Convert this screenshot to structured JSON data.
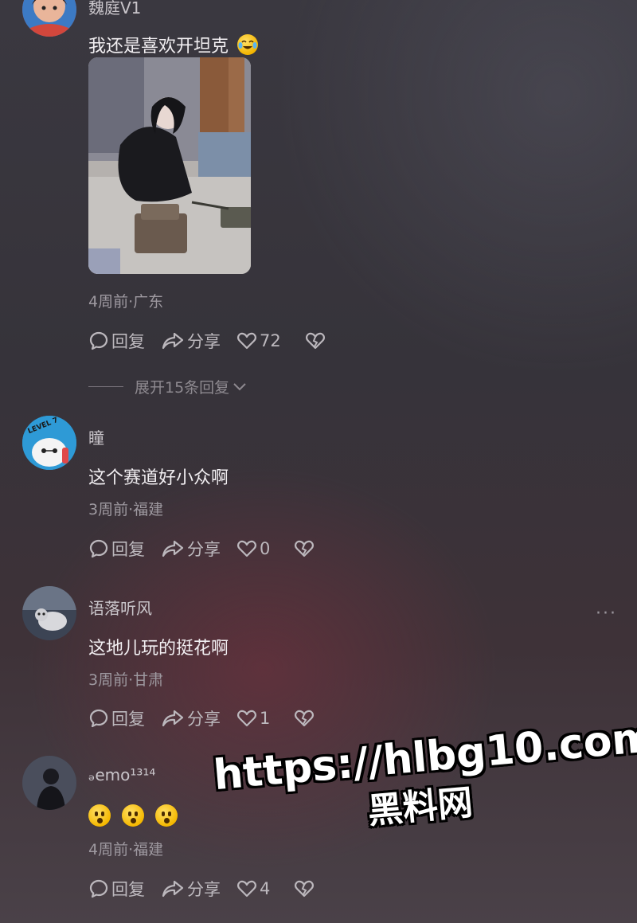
{
  "comments": [
    {
      "username": "魏庭V1",
      "text": "我还是喜欢开坦克",
      "text_emoji": "tears-of-joy-emoji",
      "meta": "4周前·广东",
      "reply_label": "回复",
      "share_label": "分享",
      "likes": "72",
      "expand_label": "展开15条回复"
    },
    {
      "username": "瞳",
      "text": "这个赛道好小众啊",
      "meta": "3周前·福建",
      "reply_label": "回复",
      "share_label": "分享",
      "likes": "0"
    },
    {
      "username": "语落听风",
      "text": "这地儿玩的挺花啊",
      "meta": "3周前·甘肃",
      "reply_label": "回复",
      "share_label": "分享",
      "likes": "1",
      "more": "···"
    },
    {
      "username": "ₔemo¹³¹⁴",
      "emojis": [
        "astonished-emoji",
        "astonished-emoji",
        "astonished-emoji"
      ],
      "meta": "4周前·福建",
      "reply_label": "回复",
      "share_label": "分享",
      "likes": "4"
    }
  ],
  "avatar_badge": "LEVEL 7",
  "watermark": {
    "url": "https://hlbg10.com",
    "name": "黑料网"
  },
  "icons": {
    "reply": "comment-bubble-icon",
    "share": "share-arrow-icon",
    "like": "heart-outline-icon",
    "dislike": "broken-heart-icon",
    "expand": "chevron-down-icon"
  },
  "colors": {
    "background": "#3a3840",
    "text": "#f2eff2",
    "muted": "#9e99a0",
    "accent_glow": "#78303e"
  }
}
